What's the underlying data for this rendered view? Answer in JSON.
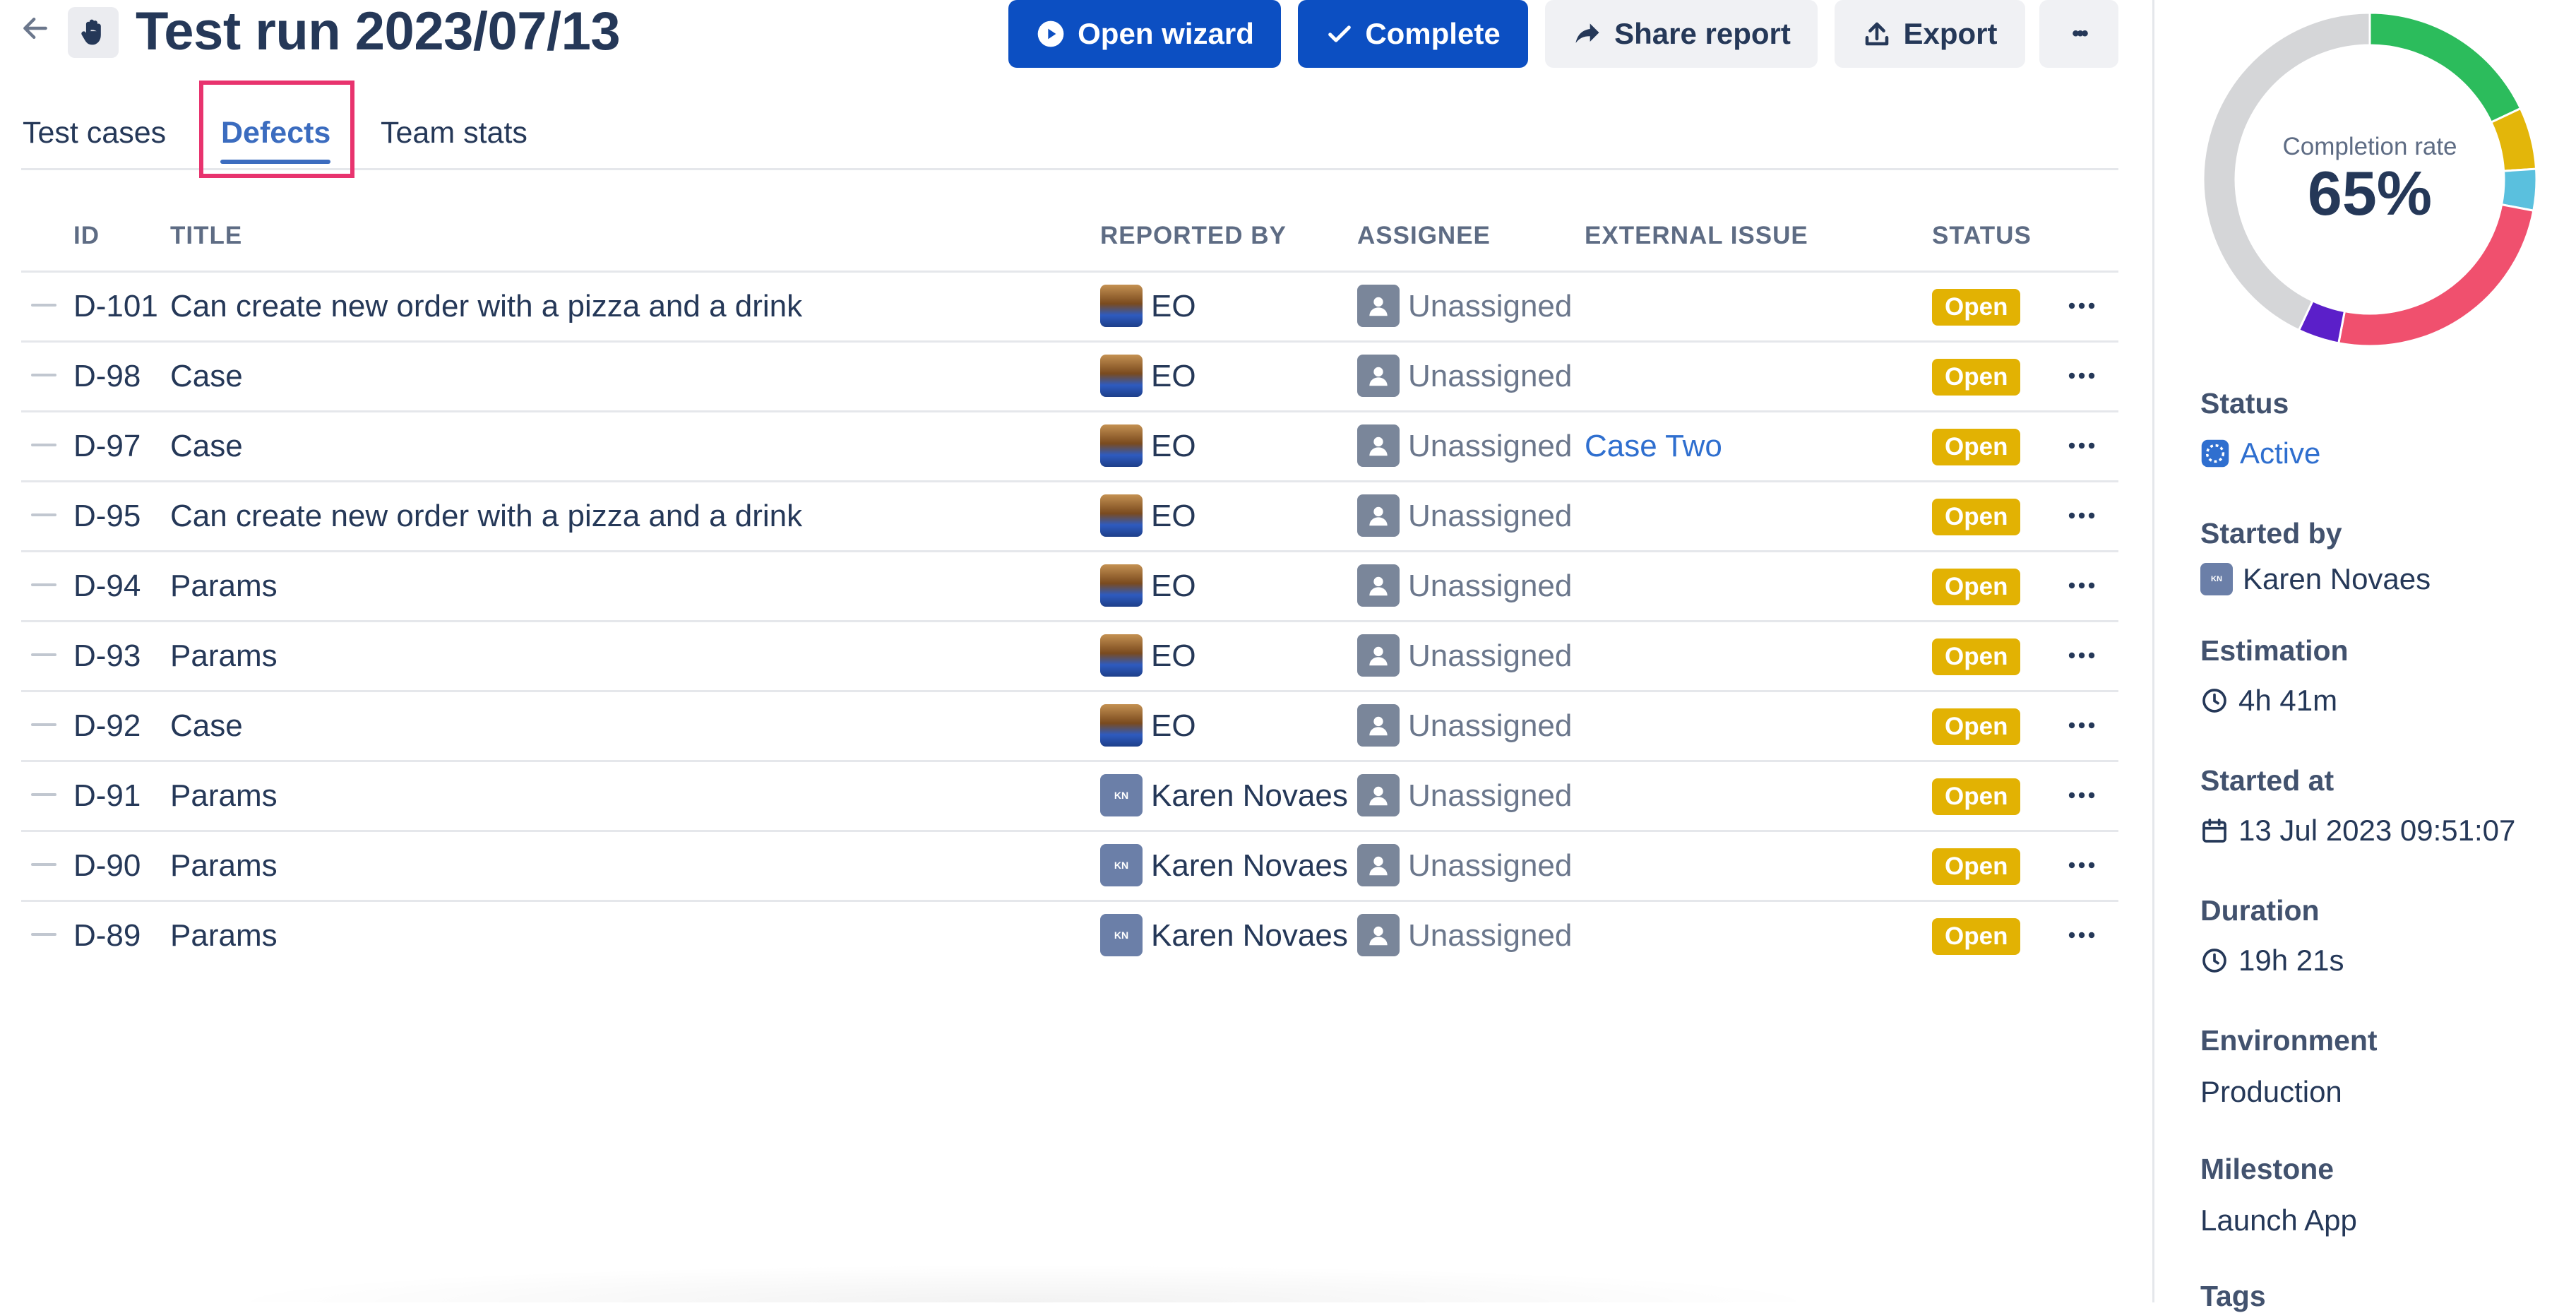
{
  "header": {
    "title": "Test run 2023/07/13",
    "buttons": {
      "open_wizard": "Open wizard",
      "complete": "Complete",
      "share_report": "Share report",
      "export": "Export",
      "more": "•••"
    }
  },
  "tabs": [
    {
      "label": "Test cases",
      "active": false
    },
    {
      "label": "Defects",
      "active": true
    },
    {
      "label": "Team stats",
      "active": false
    }
  ],
  "table": {
    "columns": {
      "id": "ID",
      "title": "TITLE",
      "reported_by": "REPORTED BY",
      "assignee": "ASSIGNEE",
      "external_issue": "EXTERNAL ISSUE",
      "status": "STATUS"
    },
    "rows": [
      {
        "id": "D-101",
        "title": "Can create new order with a pizza and a drink",
        "reporter": "EO",
        "reporter_avatar": "photo",
        "assignee": "Unassigned",
        "external": "",
        "status": "Open"
      },
      {
        "id": "D-98",
        "title": "Case",
        "reporter": "EO",
        "reporter_avatar": "photo",
        "assignee": "Unassigned",
        "external": "",
        "status": "Open"
      },
      {
        "id": "D-97",
        "title": "Case",
        "reporter": "EO",
        "reporter_avatar": "photo",
        "assignee": "Unassigned",
        "external": "Case Two",
        "status": "Open"
      },
      {
        "id": "D-95",
        "title": "Can create new order with a pizza and a drink",
        "reporter": "EO",
        "reporter_avatar": "photo",
        "assignee": "Unassigned",
        "external": "",
        "status": "Open"
      },
      {
        "id": "D-94",
        "title": "Params",
        "reporter": "EO",
        "reporter_avatar": "photo",
        "assignee": "Unassigned",
        "external": "",
        "status": "Open"
      },
      {
        "id": "D-93",
        "title": "Params",
        "reporter": "EO",
        "reporter_avatar": "photo",
        "assignee": "Unassigned",
        "external": "",
        "status": "Open"
      },
      {
        "id": "D-92",
        "title": "Case",
        "reporter": "EO",
        "reporter_avatar": "photo",
        "assignee": "Unassigned",
        "external": "",
        "status": "Open"
      },
      {
        "id": "D-91",
        "title": "Params",
        "reporter": "Karen Novaes",
        "reporter_avatar": "initials",
        "assignee": "Unassigned",
        "external": "",
        "status": "Open"
      },
      {
        "id": "D-90",
        "title": "Params",
        "reporter": "Karen Novaes",
        "reporter_avatar": "initials",
        "assignee": "Unassigned",
        "external": "",
        "status": "Open"
      },
      {
        "id": "D-89",
        "title": "Params",
        "reporter": "Karen Novaes",
        "reporter_avatar": "initials",
        "assignee": "Unassigned",
        "external": "",
        "status": "Open"
      }
    ],
    "initials": "KN"
  },
  "sidebar": {
    "completion": {
      "label": "Completion rate",
      "value": "65%",
      "segments": [
        {
          "color": "#2cbc5c",
          "fraction": 0.18
        },
        {
          "color": "#e3b60a",
          "fraction": 0.06
        },
        {
          "color": "#5ac0de",
          "fraction": 0.04
        },
        {
          "color": "#f0506e",
          "fraction": 0.25
        },
        {
          "color": "#5b1fc9",
          "fraction": 0.04
        },
        {
          "color": "#d5d6d8",
          "fraction": 0.43
        }
      ]
    },
    "status_label": "Status",
    "status_value": "Active",
    "started_by_label": "Started by",
    "started_by_value": "Karen Novaes",
    "estimation_label": "Estimation",
    "estimation_value": "4h 41m",
    "started_at_label": "Started at",
    "started_at_value": "13 Jul 2023 09:51:07",
    "duration_label": "Duration",
    "duration_value": "19h 21s",
    "environment_label": "Environment",
    "environment_value": "Production",
    "milestone_label": "Milestone",
    "milestone_value": "Launch App",
    "tags_label": "Tags"
  }
}
